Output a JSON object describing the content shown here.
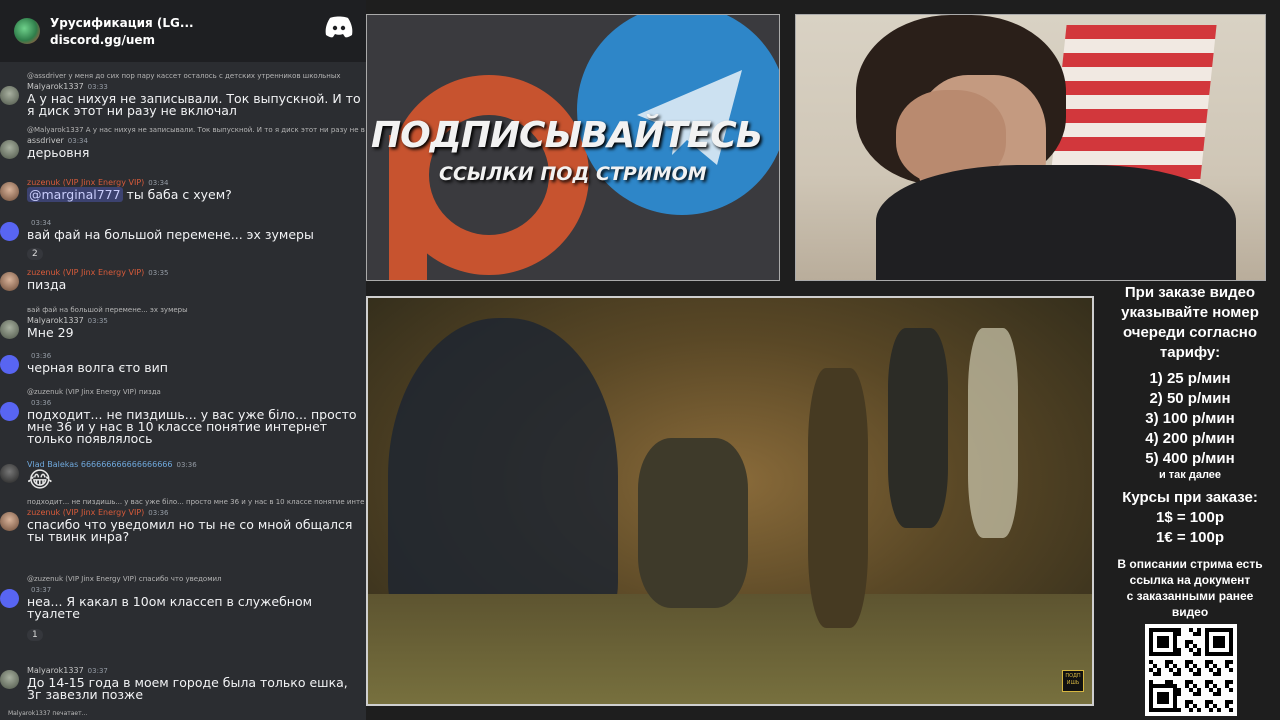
{
  "server": {
    "name": "Урусификация (LG...",
    "link": "discord.gg/uem",
    "icon": "server-avatar-icon",
    "logo": "discord-logo-icon"
  },
  "messages": [
    {
      "reply": "@assdriver у меня до сих пор пару кассет осталось с детских утренников школьных",
      "user": "Malyarok1337",
      "user_color": "#c7c7c7",
      "time": "03:33",
      "body": "А у нас нихуя не записывали. Ток выпускной. И то я диск этот ни разу не включал",
      "avatar": "grey"
    },
    {
      "reply": "@Malyarok1337 А у нас нихуя не записывали. Ток выпускной. И то я диск этот ни разу не включал",
      "user": "assdriver",
      "user_color": "#c7c7c7",
      "time": "03:34",
      "body": "дерьовня",
      "avatar": "grey"
    },
    {
      "user": "zuzenuk (VIP Jinx Energy VIP)",
      "user_color": "#d85b3a",
      "time": "03:34",
      "body_mention": "@marginal777",
      "body": " ты баба с хуем?",
      "avatar": "photo"
    },
    {
      "user": "",
      "user_color": "#c7c7c7",
      "time": "03:34",
      "body": "вай фай на большой перемене... эх зумеры",
      "avatar": "discord",
      "reaction": "2"
    },
    {
      "user": "zuzenuk (VIP Jinx Energy VIP)",
      "user_color": "#d85b3a",
      "time": "03:35",
      "body": "пизда",
      "avatar": "photo"
    },
    {
      "reply": "вай фай на большой перемене... эх зумеры",
      "user": "Malyarok1337",
      "user_color": "#c7c7c7",
      "time": "03:35",
      "body": "Мне 29",
      "avatar": "grey"
    },
    {
      "user": "",
      "user_color": "#c7c7c7",
      "time": "03:36",
      "body": "черная волга єто вип",
      "avatar": "discord"
    },
    {
      "reply": "@zuzenuk (VIP Jinx Energy VIP) пизда",
      "user": "",
      "user_color": "#c7c7c7",
      "time": "03:36",
      "body": "подходит... не пиздишь... у вас уже біло... просто мне 36 и у нас в 10 классе понятие интернет только появлялось",
      "avatar": "discord"
    },
    {
      "user": "Vlad Balekas 666666666666666666",
      "user_color": "#6fa8dc",
      "time": "03:36",
      "body": "😂",
      "avatar": "vlad",
      "emoji_only": true
    },
    {
      "reply": "подходит... не пиздишь... у вас уже біло... просто мне 36 и у нас в 10 классе понятие интернет только появлялось",
      "user": "zuzenuk (VIP Jinx Energy VIP)",
      "user_color": "#d85b3a",
      "time": "03:36",
      "body": "спасибо что уведомил но ты не со мной общался ты твинк инра?",
      "avatar": "photo"
    },
    {
      "reply": "@zuzenuk (VIP Jinx Energy VIP) спасибо что уведомил",
      "user": "",
      "user_color": "#c7c7c7",
      "time": "03:37",
      "body": "неа... Я какал в 10ом классеп в служебном туалете",
      "avatar": "discord",
      "reaction": "1"
    },
    {
      "user": "Malyarok1337",
      "user_color": "#c7c7c7",
      "time": "03:37",
      "body": "До 14-15 года в моем городе была только ешка, 3г завезли позже",
      "avatar": "grey"
    }
  ],
  "typing": "Malyarok1337 печатает...",
  "promo": {
    "title": "ПОДПИСЫВАЙТЕСЬ",
    "subtitle": "ССЫЛКИ ПОД СТРИМОМ"
  },
  "video": {
    "logo_text": "ПОДП ИШЬ"
  },
  "info": {
    "intro": [
      "При заказе видео",
      "указывайте номер",
      "очереди согласно",
      "тарифу:"
    ],
    "tariffs": [
      "1) 25 р/мин",
      "2) 50 р/мин",
      "3) 100 р/мин",
      "4) 200 р/мин",
      "5) 400 р/мин"
    ],
    "etc": "и так далее",
    "rates_title": "Курсы при заказе:",
    "rates": [
      "1$ = 100р",
      "1€ = 100р"
    ],
    "desc": [
      "В описании стрима есть",
      "ссылка на документ",
      "с заказанными ранее",
      "видео"
    ]
  },
  "colors": {
    "chat_bg": "#2b2d31",
    "discord_blurple": "#5865f2",
    "patreon_orange": "#c7532f",
    "telegram_blue": "#2e86c8"
  }
}
